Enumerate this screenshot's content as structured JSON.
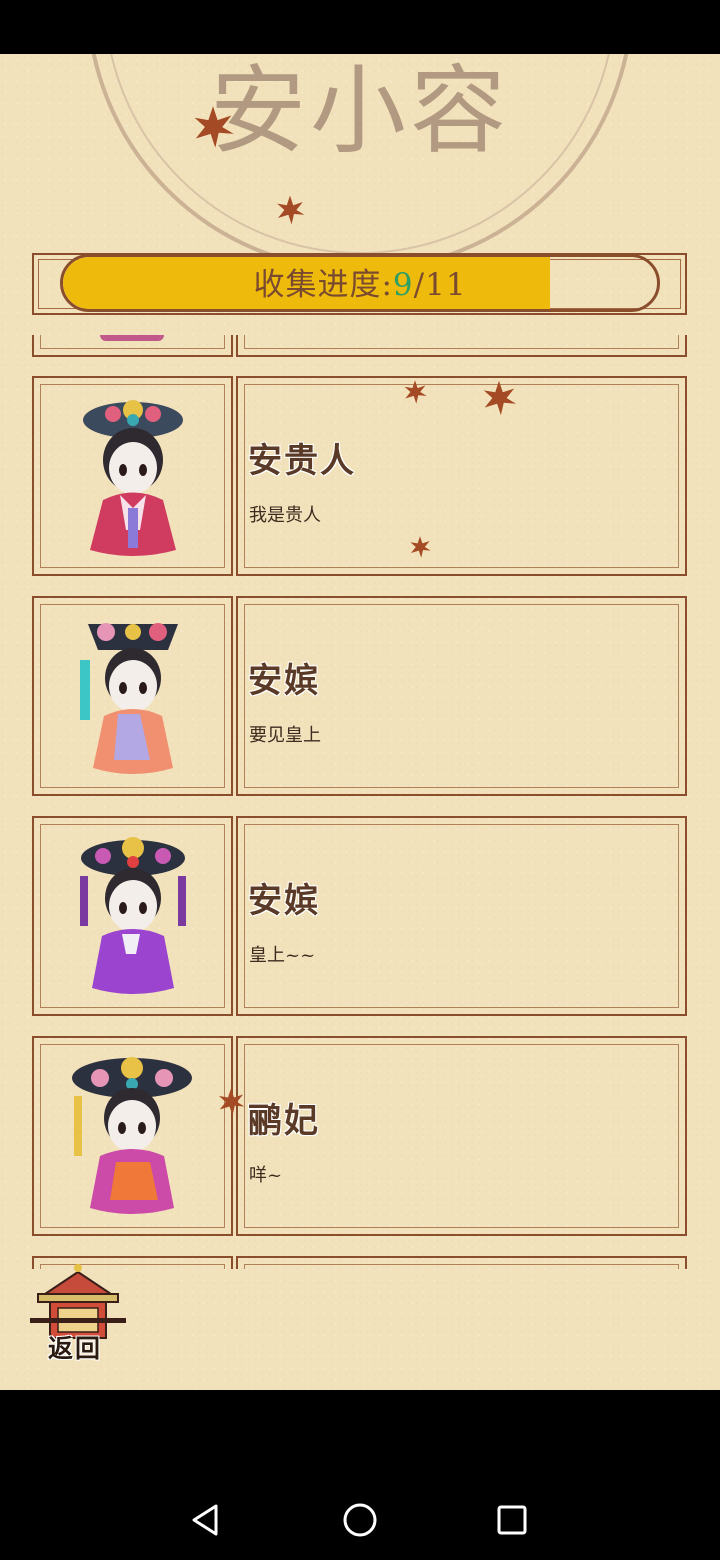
{
  "header": {
    "title": "安小容"
  },
  "progress": {
    "label": "收集进度:",
    "current": "9",
    "separator": "/",
    "total": "11",
    "fraction": 0.82
  },
  "characters": [
    {
      "name": "安贵人",
      "line": "我是贵人"
    },
    {
      "name": "安嫔",
      "line": "要见皇上"
    },
    {
      "name": "安嫔",
      "line": "皇上~~"
    },
    {
      "name": "鹂妃",
      "line": "咩~"
    }
  ],
  "footer": {
    "back_label": "返回"
  },
  "nav": {
    "back": "triangle-back-icon",
    "home": "circle-home-icon",
    "recents": "square-recents-icon"
  },
  "colors": {
    "paper": "#f2e2bb",
    "frame": "#8a4e2c",
    "progress_fill": "#eebb0c",
    "count_accent": "#2e9e63"
  }
}
